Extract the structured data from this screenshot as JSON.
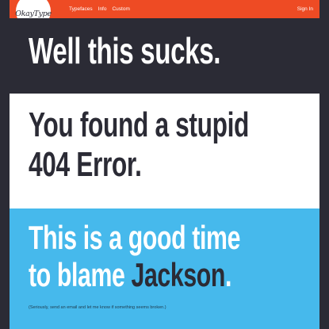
{
  "nav": {
    "logo": "OkayType",
    "links": [
      "Typefaces",
      "Info",
      "Custom"
    ],
    "signin": "Sign In"
  },
  "sections": {
    "dark": {
      "text": "Well this sucks."
    },
    "white": {
      "line1": "You found a stupid",
      "line2": "404 Error."
    },
    "blue": {
      "line1": "This is a good time",
      "line2_prefix": "to blame ",
      "name": "Jackson",
      "period": ".",
      "fine_print_prefix": "(Seriously, send an ",
      "fine_print_link": "email",
      "fine_print_suffix": " and let me know if something seems broken.)"
    }
  },
  "colors": {
    "nav_bar": "#ee4b24",
    "dark_bg": "#2b2b35",
    "white_bg": "#ffffff",
    "blue_bg": "#46b9ec"
  }
}
